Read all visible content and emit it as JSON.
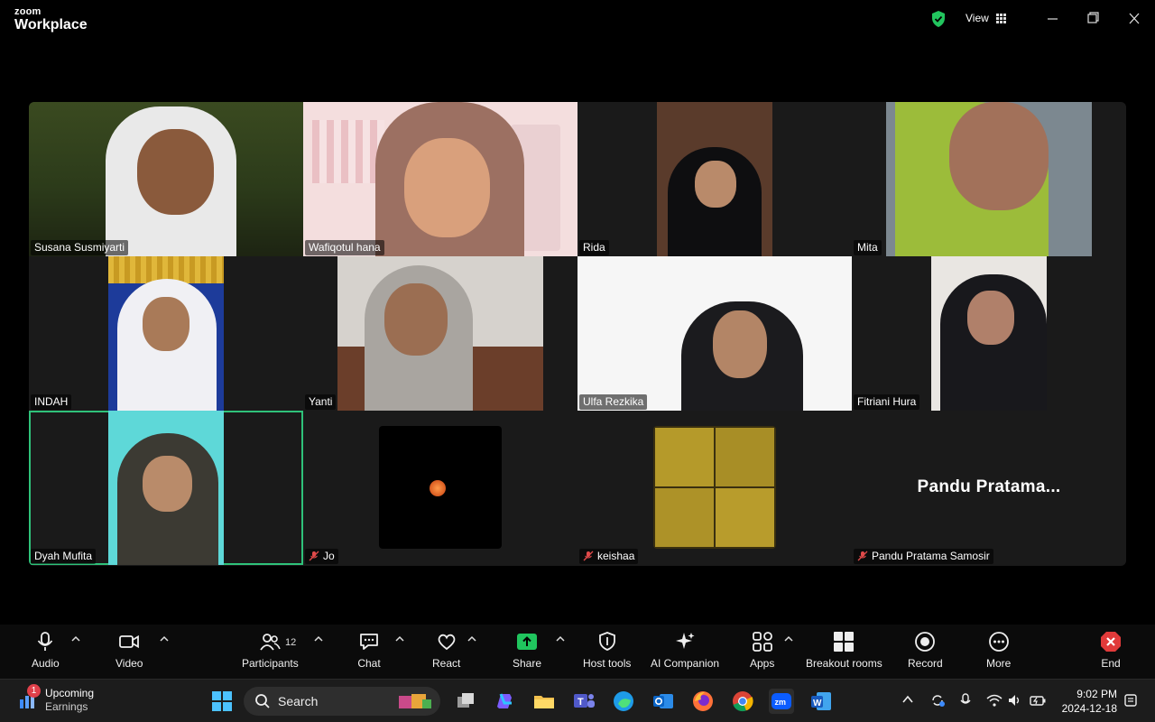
{
  "app": {
    "brand_top": "zoom",
    "brand_bottom": "Workplace",
    "view_label": "View"
  },
  "participants": [
    {
      "name": "Susana Susmiyarti",
      "muted": false
    },
    {
      "name": "Wafiqotul hana",
      "muted": false
    },
    {
      "name": "Rida",
      "muted": false
    },
    {
      "name": "Mita",
      "muted": false
    },
    {
      "name": "INDAH",
      "muted": false
    },
    {
      "name": "Yanti",
      "muted": false
    },
    {
      "name": "Ulfa Rezkika",
      "muted": false
    },
    {
      "name": "Fitriani Hura",
      "muted": false
    },
    {
      "name": "Dyah Mufita",
      "muted": false,
      "active_speaker": true
    },
    {
      "name": "Jo",
      "muted": true
    },
    {
      "name": "keishaa",
      "muted": true
    },
    {
      "name": "Pandu Pratama Samosir",
      "muted": true,
      "display_text": "Pandu Pratama..."
    }
  ],
  "toolbar": {
    "audio": "Audio",
    "video": "Video",
    "participants": "Participants",
    "participants_count": "12",
    "chat": "Chat",
    "react": "React",
    "share": "Share",
    "host_tools": "Host tools",
    "ai_companion": "AI Companion",
    "apps": "Apps",
    "breakout_rooms": "Breakout rooms",
    "record": "Record",
    "more": "More",
    "end": "End"
  },
  "taskbar": {
    "widget_title": "Upcoming",
    "widget_subtitle": "Earnings",
    "widget_badge": "1",
    "search_label": "Search",
    "time": "9:02 PM",
    "date": "2024-12-18"
  },
  "colors": {
    "active_speaker": "#2fc27a",
    "share_green": "#20c55e",
    "end_red": "#e03a3a",
    "shield_green": "#22c55e"
  }
}
